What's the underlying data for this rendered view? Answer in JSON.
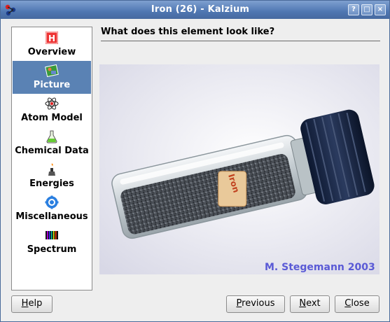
{
  "window": {
    "title": "Iron (26) - Kalzium",
    "buttons": {
      "help": "?",
      "maximize": "□",
      "close": "×"
    }
  },
  "sidebar": {
    "items": [
      {
        "label": "Overview",
        "icon": "overview-icon",
        "active": false
      },
      {
        "label": "Picture",
        "icon": "picture-icon",
        "active": true
      },
      {
        "label": "Atom Model",
        "icon": "atom-model-icon",
        "active": false
      },
      {
        "label": "Chemical Data",
        "icon": "chemical-data-icon",
        "active": false
      },
      {
        "label": "Energies",
        "icon": "energies-icon",
        "active": false
      },
      {
        "label": "Miscellaneous",
        "icon": "miscellaneous-icon",
        "active": false
      },
      {
        "label": "Spectrum",
        "icon": "spectrum-icon",
        "active": false
      }
    ]
  },
  "main": {
    "heading": "What does this element look like?",
    "image": {
      "label_on_vial": "Iron",
      "credit": "M. Stegemann 2003"
    }
  },
  "footer": {
    "help": {
      "prefix": "",
      "mnemonic": "H",
      "rest": "elp"
    },
    "previous": {
      "prefix": "",
      "mnemonic": "P",
      "rest": "revious"
    },
    "next": {
      "prefix": "",
      "mnemonic": "N",
      "rest": "ext"
    },
    "close": {
      "prefix": "",
      "mnemonic": "C",
      "rest": "lose"
    }
  },
  "colors": {
    "titlebar": "#4f77b2",
    "selection": "#5a82b4",
    "credit_text": "#5a5ad6"
  }
}
